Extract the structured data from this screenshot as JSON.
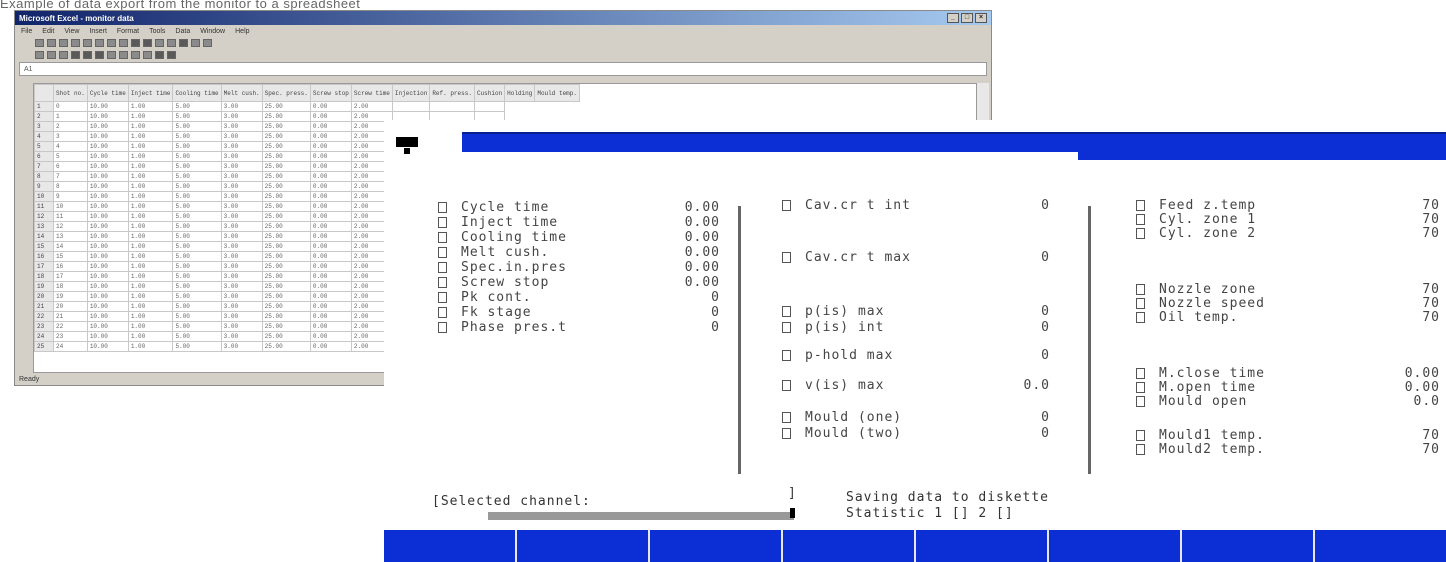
{
  "caption": "Example of data export from the monitor to a spreadsheet",
  "spreadsheet": {
    "title": "Microsoft Excel - monitor data",
    "menu": [
      "File",
      "Edit",
      "View",
      "Insert",
      "Format",
      "Tools",
      "Data",
      "Window",
      "Help"
    ],
    "formula_text": "A1",
    "headers": [
      "",
      "Shot no.",
      "Cycle time",
      "Inject time",
      "Cooling time",
      "Melt cush.",
      "Spec. press.",
      "Screw stop",
      "Screw time",
      "Injection",
      "Ref. press.",
      "Cushion",
      "Holding",
      "Mould temp."
    ],
    "rows": [
      [
        "1",
        "0",
        "10.00",
        "1.00",
        "5.00",
        "3.00",
        "25.00",
        "0.00",
        "2.00",
        "",
        "",
        ""
      ],
      [
        "2",
        "1",
        "10.00",
        "1.00",
        "5.00",
        "3.00",
        "25.00",
        "0.00",
        "2.00",
        "",
        "",
        ""
      ],
      [
        "3",
        "2",
        "10.00",
        "1.00",
        "5.00",
        "3.00",
        "25.00",
        "0.00",
        "2.00",
        "",
        "",
        ""
      ],
      [
        "4",
        "3",
        "10.00",
        "1.00",
        "5.00",
        "3.00",
        "25.00",
        "0.00",
        "2.00",
        "",
        "",
        ""
      ],
      [
        "5",
        "4",
        "10.00",
        "1.00",
        "5.00",
        "3.00",
        "25.00",
        "0.00",
        "2.00",
        "",
        "",
        ""
      ],
      [
        "6",
        "5",
        "10.00",
        "1.00",
        "5.00",
        "3.00",
        "25.00",
        "0.00",
        "2.00",
        "",
        "",
        ""
      ],
      [
        "7",
        "6",
        "10.00",
        "1.00",
        "5.00",
        "3.00",
        "25.00",
        "0.00",
        "2.00",
        "",
        "",
        ""
      ],
      [
        "8",
        "7",
        "10.00",
        "1.00",
        "5.00",
        "3.00",
        "25.00",
        "0.00",
        "2.00",
        "",
        "",
        ""
      ],
      [
        "9",
        "8",
        "10.00",
        "1.00",
        "5.00",
        "3.00",
        "25.00",
        "0.00",
        "2.00",
        "",
        "",
        ""
      ],
      [
        "10",
        "9",
        "10.00",
        "1.00",
        "5.00",
        "3.00",
        "25.00",
        "0.00",
        "2.00",
        "",
        "",
        ""
      ],
      [
        "11",
        "10",
        "10.00",
        "1.00",
        "5.00",
        "3.00",
        "25.00",
        "0.00",
        "2.00",
        "",
        "",
        ""
      ],
      [
        "12",
        "11",
        "10.00",
        "1.00",
        "5.00",
        "3.00",
        "25.00",
        "0.00",
        "2.00",
        "",
        "",
        ""
      ],
      [
        "13",
        "12",
        "10.00",
        "1.00",
        "5.00",
        "3.00",
        "25.00",
        "0.00",
        "2.00",
        "",
        "",
        ""
      ],
      [
        "14",
        "13",
        "10.00",
        "1.00",
        "5.00",
        "3.00",
        "25.00",
        "0.00",
        "2.00",
        "",
        "",
        ""
      ],
      [
        "15",
        "14",
        "10.00",
        "1.00",
        "5.00",
        "3.00",
        "25.00",
        "0.00",
        "2.00",
        "",
        "",
        ""
      ],
      [
        "16",
        "15",
        "10.00",
        "1.00",
        "5.00",
        "3.00",
        "25.00",
        "0.00",
        "2.00",
        "",
        "",
        ""
      ],
      [
        "17",
        "16",
        "10.00",
        "1.00",
        "5.00",
        "3.00",
        "25.00",
        "0.00",
        "2.00",
        "",
        "",
        ""
      ],
      [
        "18",
        "17",
        "10.00",
        "1.00",
        "5.00",
        "3.00",
        "25.00",
        "0.00",
        "2.00",
        "",
        "",
        ""
      ],
      [
        "19",
        "18",
        "10.00",
        "1.00",
        "5.00",
        "3.00",
        "25.00",
        "0.00",
        "2.00",
        "",
        "",
        ""
      ],
      [
        "20",
        "19",
        "10.00",
        "1.00",
        "5.00",
        "3.00",
        "25.00",
        "0.00",
        "2.00",
        "",
        "",
        ""
      ],
      [
        "21",
        "20",
        "10.00",
        "1.00",
        "5.00",
        "3.00",
        "25.00",
        "0.00",
        "2.00",
        "",
        "",
        ""
      ],
      [
        "22",
        "21",
        "10.00",
        "1.00",
        "5.00",
        "3.00",
        "25.00",
        "0.00",
        "2.00",
        "",
        "",
        ""
      ],
      [
        "23",
        "22",
        "10.00",
        "1.00",
        "5.00",
        "3.00",
        "25.00",
        "0.00",
        "2.00",
        "",
        "",
        ""
      ],
      [
        "24",
        "23",
        "10.00",
        "1.00",
        "5.00",
        "3.00",
        "25.00",
        "0.00",
        "2.00",
        "",
        "",
        ""
      ],
      [
        "25",
        "24",
        "10.00",
        "1.00",
        "5.00",
        "3.00",
        "25.00",
        "0.00",
        "2.00",
        "",
        "",
        ""
      ]
    ],
    "status": "Ready"
  },
  "terminal": {
    "col1": {
      "labels": [
        "Cycle time",
        "Inject time",
        "Cooling time",
        "Melt cush.",
        "Spec.in.pres",
        "Screw stop",
        "Pk    cont.",
        "Fk    stage",
        "Phase pres.t"
      ],
      "values": [
        "0.00",
        "0.00",
        "0.00",
        "0.00",
        "0.00",
        "0.00",
        "0",
        "0",
        "0"
      ]
    },
    "col2": {
      "items": [
        {
          "label": "Cav.cr t int",
          "value": "0"
        },
        {
          "label": "Cav.cr t max",
          "value": "0"
        },
        {
          "label": "p(is)  max",
          "value": "0"
        },
        {
          "label": "p(is)  int",
          "value": "0"
        },
        {
          "label": "p-hold max",
          "value": "0"
        },
        {
          "label": "v(is)  max",
          "value": "0.0"
        },
        {
          "label": "Mould  (one)",
          "value": "0"
        },
        {
          "label": "Mould  (two)",
          "value": "0"
        }
      ]
    },
    "col3": {
      "items": [
        {
          "label": "Feed  z.temp",
          "value": "70"
        },
        {
          "label": "Cyl.  zone 1",
          "value": "70"
        },
        {
          "label": "Cyl.  zone 2",
          "value": "70"
        },
        {
          "label": "Nozzle  zone",
          "value": "70"
        },
        {
          "label": "Nozzle speed",
          "value": "70"
        },
        {
          "label": "Oil   temp.",
          "value": "70"
        },
        {
          "label": "M.close time",
          "value": "0.00"
        },
        {
          "label": "M.open  time",
          "value": "0.00"
        },
        {
          "label": "Mould open",
          "value": "0.0"
        },
        {
          "label": "Mould1 temp.",
          "value": "70"
        },
        {
          "label": "Mould2 temp.",
          "value": "70"
        }
      ]
    },
    "selected_channel": "[Selected channel:",
    "selected_mark": "]",
    "saving": "Saving data to diskette",
    "diskette": "Statistic 1  []       2 []",
    "fkeys": [
      "",
      "",
      "",
      "",
      "",
      "",
      "",
      ""
    ]
  }
}
